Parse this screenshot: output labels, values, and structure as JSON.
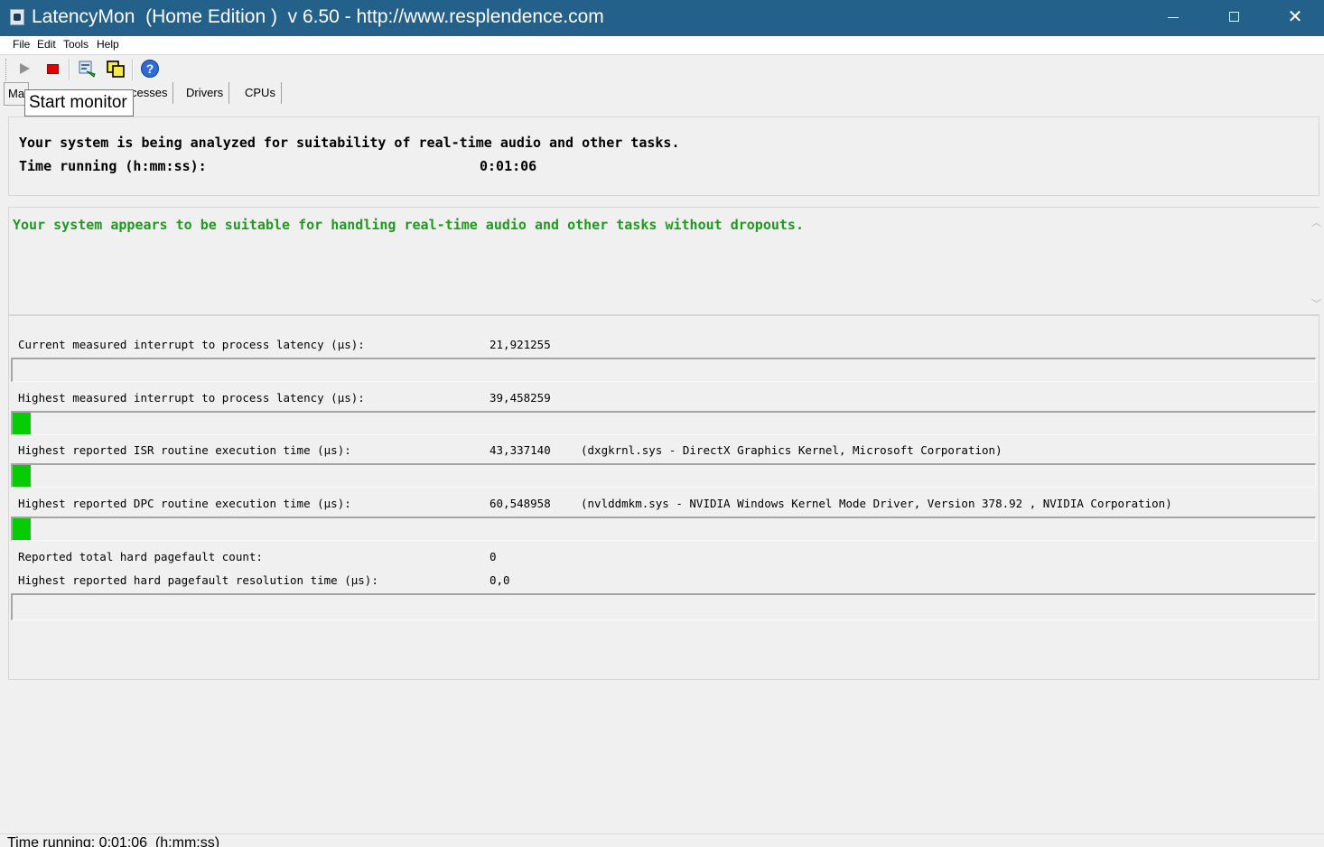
{
  "window": {
    "title": "LatencyMon  (Home Edition )  v 6.50 - http://www.resplendence.com"
  },
  "menu": {
    "items": [
      "File",
      "Edit",
      "Tools",
      "Help"
    ]
  },
  "toolbar": {
    "buttons": [
      "play-icon",
      "stop-icon",
      "report-icon",
      "copy-icon",
      "help-icon"
    ],
    "tooltip": "Start monitor",
    "help_glyph": "?"
  },
  "tabs": [
    "Ma",
    "cesses",
    "Drivers",
    "CPUs"
  ],
  "analysis": {
    "line1": "Your system is being analyzed for suitability of real-time audio and other tasks.",
    "time_label": "Time running (h:mm:ss):",
    "time_value": "0:01:06"
  },
  "verdict": {
    "text": "Your system appears to be suitable for handling real-time audio and other tasks without dropouts.",
    "color": "#1f9a1f"
  },
  "metrics": [
    {
      "label": "Current measured interrupt to process latency (µs):",
      "value": "21,921255",
      "detail": "",
      "bar_fraction": 0
    },
    {
      "label": "Highest measured interrupt to process latency (µs):",
      "value": "39,458259",
      "detail": "",
      "bar_fraction": 0.014
    },
    {
      "label": "Highest reported ISR routine execution time (µs):",
      "value": "43,337140",
      "detail": "(dxgkrnl.sys - DirectX Graphics Kernel, Microsoft Corporation)",
      "bar_fraction": 0.014
    },
    {
      "label": "Highest reported DPC routine execution time (µs):",
      "value": "60,548958",
      "detail": "(nvlddmkm.sys - NVIDIA Windows Kernel Mode Driver, Version 378.92 , NVIDIA Corporation)",
      "bar_fraction": 0.014
    }
  ],
  "pagefaults": {
    "count_label": "Reported total hard pagefault count:",
    "count_value": "0",
    "time_label": "Highest reported hard pagefault resolution time (µs):",
    "time_value": "0,0",
    "bar_fraction": 0
  },
  "statusbar": {
    "text": "Time running: 0:01:06  (h:mm:ss)"
  },
  "colors": {
    "titlebar": "#24618a",
    "bar_fill": "#06cc06"
  }
}
